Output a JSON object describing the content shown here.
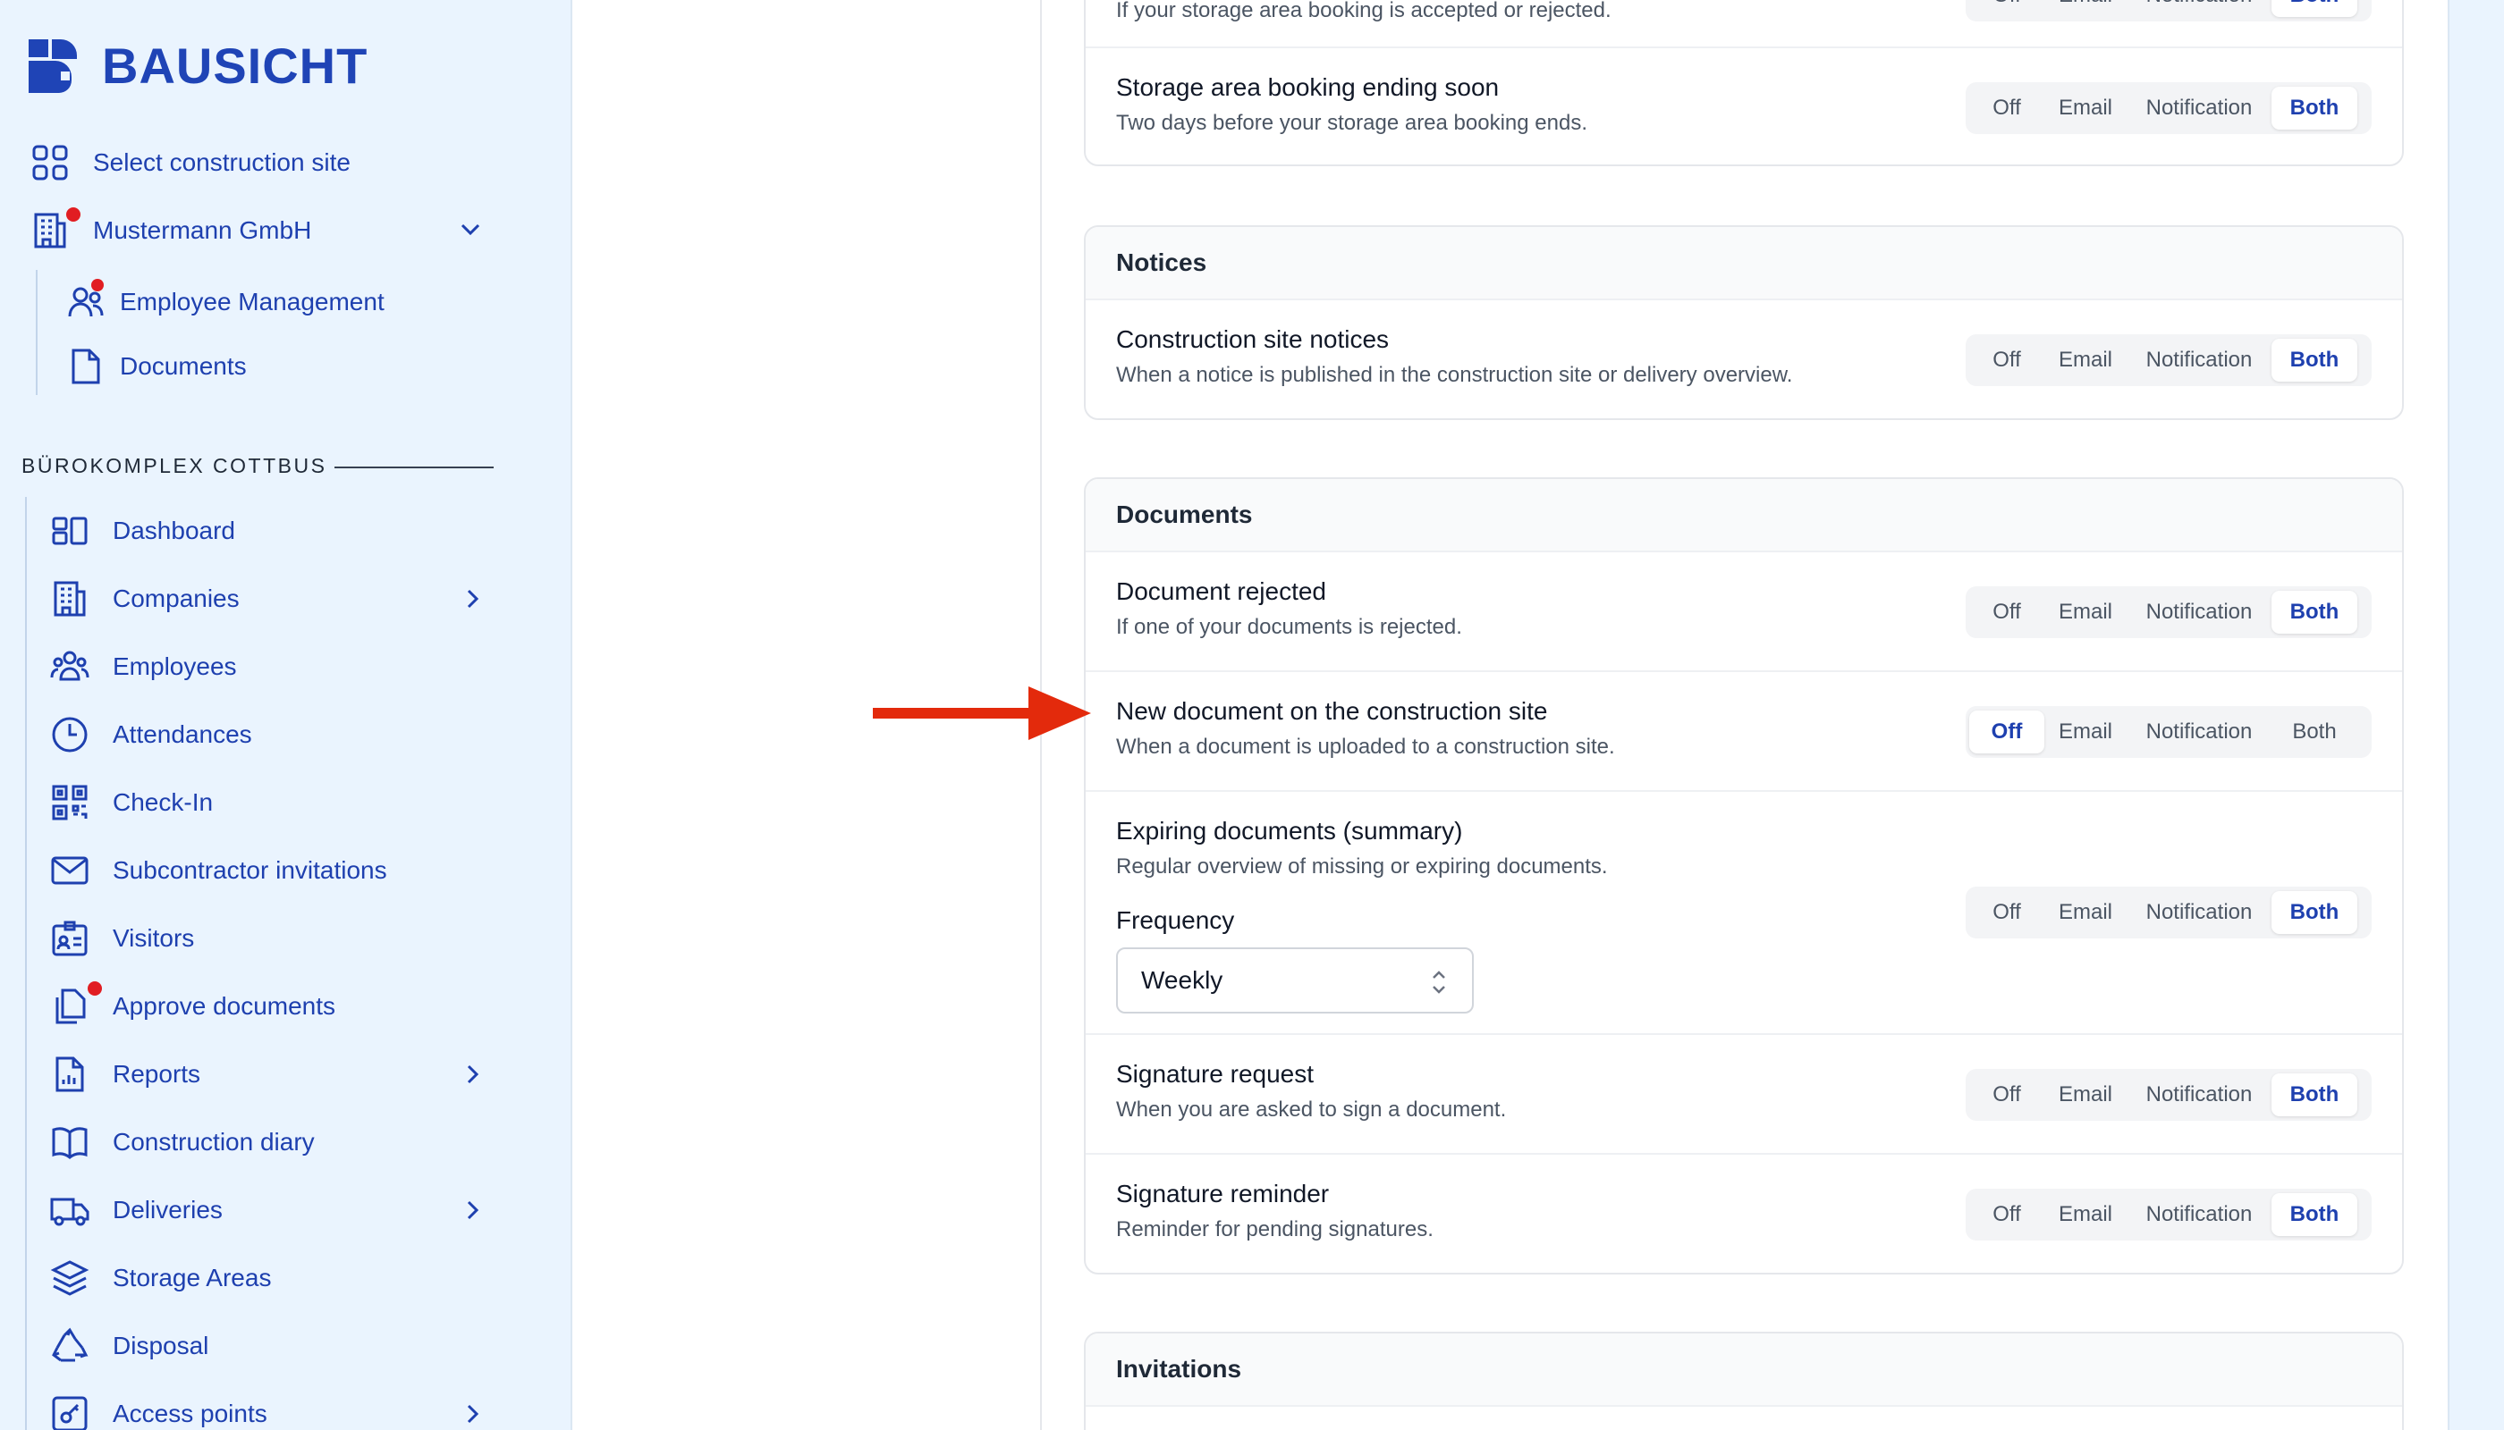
{
  "brand": {
    "name": "BAUSICHT",
    "accent": "#1f44b6",
    "badge_color": "#e11d22",
    "arrow_color": "#e32a0c"
  },
  "sidebar": {
    "top_items": [
      {
        "label": "Select construction site",
        "icon": "grid-icon"
      },
      {
        "label": "Mustermann GmbH",
        "icon": "building-icon",
        "badge": true,
        "chevron": "down"
      }
    ],
    "company_items": [
      {
        "label": "Employee Management",
        "icon": "users-icon",
        "badge": true
      },
      {
        "label": "Documents",
        "icon": "document-icon"
      }
    ],
    "section_title": "BÜROKOMPLEX COTTBUS",
    "site_items": [
      {
        "label": "Dashboard",
        "icon": "dashboard-icon"
      },
      {
        "label": "Companies",
        "icon": "building-icon",
        "chevron": "right"
      },
      {
        "label": "Employees",
        "icon": "users-group-icon"
      },
      {
        "label": "Attendances",
        "icon": "clock-icon"
      },
      {
        "label": "Check-In",
        "icon": "qr-code-icon"
      },
      {
        "label": "Subcontractor invitations",
        "icon": "envelope-icon"
      },
      {
        "label": "Visitors",
        "icon": "id-card-icon"
      },
      {
        "label": "Approve documents",
        "icon": "documents-icon",
        "badge": true
      },
      {
        "label": "Reports",
        "icon": "report-icon",
        "chevron": "right"
      },
      {
        "label": "Construction diary",
        "icon": "book-icon"
      },
      {
        "label": "Deliveries",
        "icon": "truck-icon",
        "chevron": "right"
      },
      {
        "label": "Storage Areas",
        "icon": "layers-icon"
      },
      {
        "label": "Disposal",
        "icon": "recycle-icon"
      },
      {
        "label": "Access points",
        "icon": "key-icon",
        "chevron": "right"
      }
    ]
  },
  "options": [
    "Off",
    "Email",
    "Notification",
    "Both"
  ],
  "cards": {
    "storage": {
      "partial_desc": "If your storage area booking is accepted or rejected.",
      "row": {
        "title": "Storage area booking ending soon",
        "desc": "Two days before your storage area booking ends.",
        "selected": "Both"
      }
    },
    "notices": {
      "title": "Notices",
      "row": {
        "title": "Construction site notices",
        "desc": "When a notice is published in the construction site or delivery overview.",
        "selected": "Both"
      }
    },
    "documents": {
      "title": "Documents",
      "rows": [
        {
          "title": "Document rejected",
          "desc": "If one of your documents is rejected.",
          "selected": "Both"
        },
        {
          "title": "New document on the construction site",
          "desc": "When a document is uploaded to a construction site.",
          "selected": "Off"
        },
        {
          "title": "Expiring documents (summary)",
          "desc": "Regular overview of missing or expiring documents.",
          "selected": "Both",
          "frequency_label": "Frequency",
          "frequency_value": "Weekly"
        },
        {
          "title": "Signature request",
          "desc": "When you are asked to sign a document.",
          "selected": "Both"
        },
        {
          "title": "Signature reminder",
          "desc": "Reminder for pending signatures.",
          "selected": "Both"
        }
      ]
    },
    "invitations": {
      "title": "Invitations"
    }
  }
}
